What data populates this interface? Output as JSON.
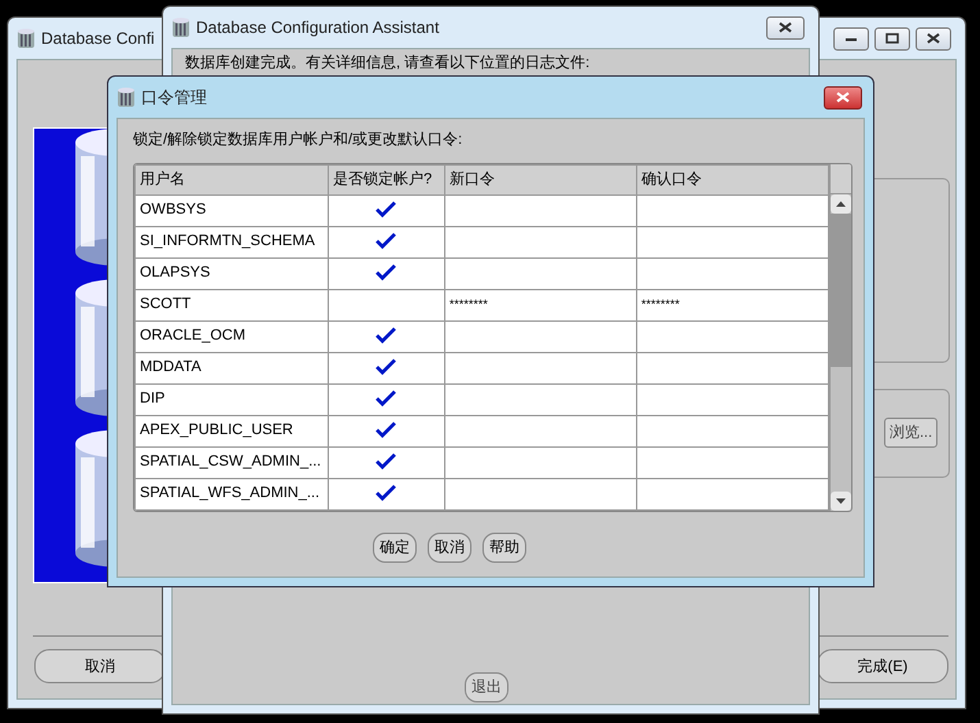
{
  "back_window": {
    "title": "Database Confi",
    "browse_button": "浏览...",
    "buttons": [
      {
        "label": "取消"
      },
      {
        "label": "完成(E)"
      }
    ]
  },
  "middle_window": {
    "title": "Database Configuration Assistant",
    "message": "数据库创建完成。有关详细信息, 请查看以下位置的日志文件:",
    "exit_button": "退出"
  },
  "dialog": {
    "title": "口令管理",
    "instruction": "锁定/解除锁定数据库用户帐户和/或更改默认口令:",
    "table": {
      "columns": [
        "用户名",
        "是否锁定帐户?",
        "新口令",
        "确认口令"
      ],
      "rows": [
        {
          "user": "OWBSYS",
          "locked": true
        },
        {
          "user": "SI_INFORMTN_SCHEMA",
          "locked": true
        },
        {
          "user": "OLAPSYS",
          "locked": true
        },
        {
          "user": "SCOTT",
          "locked": false,
          "new_password": "********",
          "confirm_password": "********"
        },
        {
          "user": "ORACLE_OCM",
          "locked": true
        },
        {
          "user": "MDDATA",
          "locked": true
        },
        {
          "user": "DIP",
          "locked": true
        },
        {
          "user": "APEX_PUBLIC_USER",
          "locked": true
        },
        {
          "user": "SPATIAL_CSW_ADMIN_...",
          "locked": true
        },
        {
          "user": "SPATIAL_WFS_ADMIN_...",
          "locked": true
        }
      ]
    },
    "buttons": [
      "确定",
      "取消",
      "帮助"
    ]
  }
}
